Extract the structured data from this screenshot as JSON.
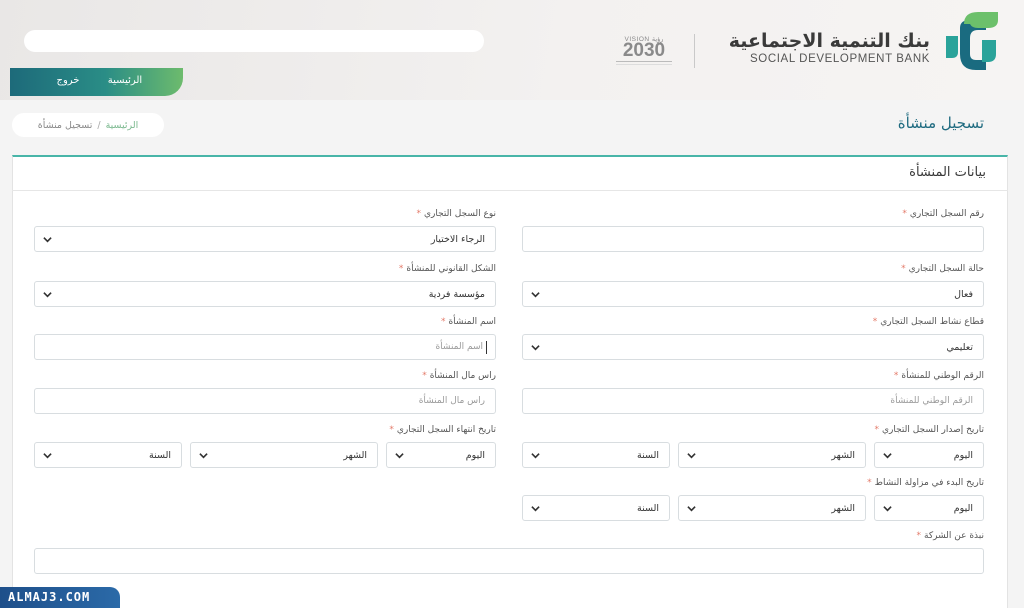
{
  "header": {
    "bank_name_ar": "بنك التنمية الاجتماعية",
    "bank_name_en": "SOCIAL DEVELOPMENT BANK",
    "vision_label": "VISION رؤية",
    "vision_year": "2030",
    "brand_color": "#48b5a8"
  },
  "nav": {
    "home": "الرئيسية",
    "logout": "خروج"
  },
  "breadcrumb": {
    "home": "الرئيسية",
    "separator": "/",
    "current": "تسجيل منشأة"
  },
  "page": {
    "title": "تسجيل منشأة"
  },
  "form": {
    "section_title": "بيانات المنشأة",
    "required_mark": "*",
    "cr_number": {
      "label": "رقم السجل التجاري",
      "value": ""
    },
    "cr_type": {
      "label": "نوع السجل التجاري",
      "value": "الرجاء الاختيار"
    },
    "cr_status": {
      "label": "حالة السجل التجاري",
      "value": "فعال"
    },
    "legal_form": {
      "label": "الشكل القانوني للمنشأة",
      "value": "مؤسسة فردية"
    },
    "cr_sector": {
      "label": "قطاع نشاط السجل التجاري",
      "value": "تعليمي"
    },
    "est_name": {
      "label": "اسم المنشأة",
      "placeholder": "اسم المنشأة"
    },
    "national_no": {
      "label": "الرقم الوطني للمنشأة",
      "placeholder": "الرقم الوطني للمنشأة"
    },
    "capital": {
      "label": "راس مال المنشأة",
      "placeholder": "راس مال المنشأة"
    },
    "issue_date": {
      "label": "تاريخ إصدار السجل التجاري",
      "day": "اليوم",
      "month": "الشهر",
      "year": "السنة"
    },
    "expiry_date": {
      "label": "تاريخ انتهاء السجل التجاري",
      "day": "اليوم",
      "month": "الشهر",
      "year": "السنة"
    },
    "start_date": {
      "label": "تاريخ البدء في مزاولة النشاط",
      "day": "اليوم",
      "month": "الشهر",
      "year": "السنة"
    },
    "about": {
      "label": "نبذة عن الشركة",
      "value": ""
    }
  },
  "watermark": {
    "text": "ALMAJ3.COM"
  }
}
